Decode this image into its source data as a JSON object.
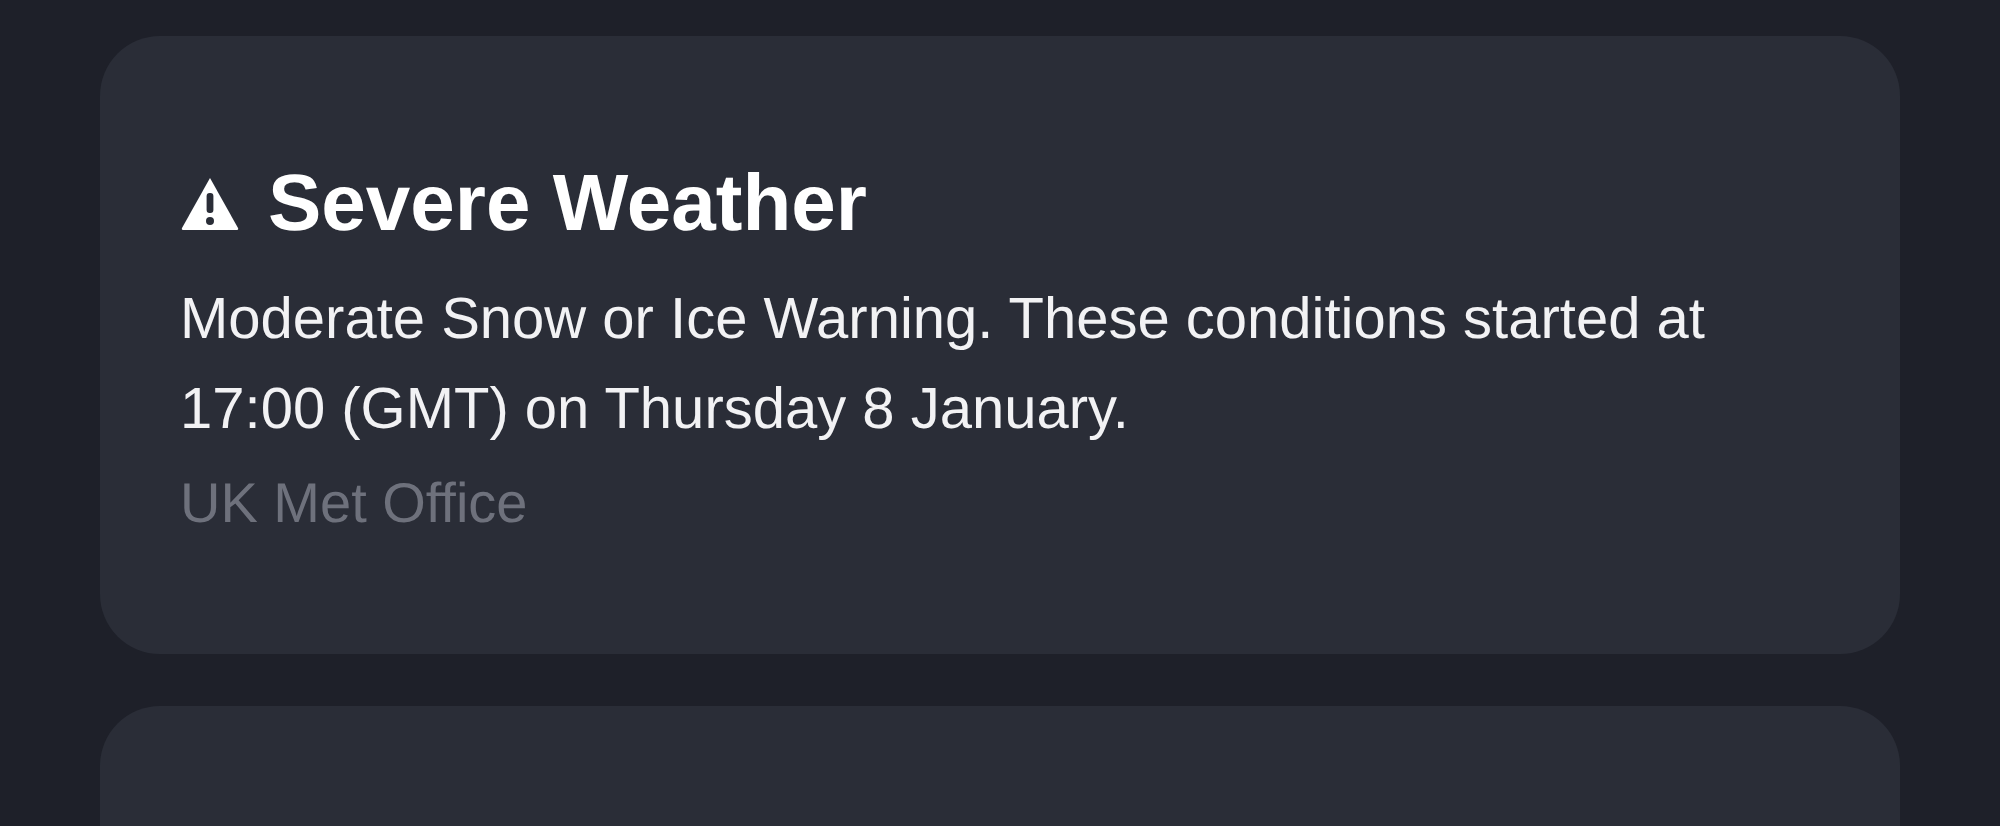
{
  "alert": {
    "title": "Severe Weather",
    "message": "Moderate Snow or Ice Warning. These conditions started at 17:00 (GMT) on Thursday 8 January.",
    "source": "UK Met Office"
  }
}
